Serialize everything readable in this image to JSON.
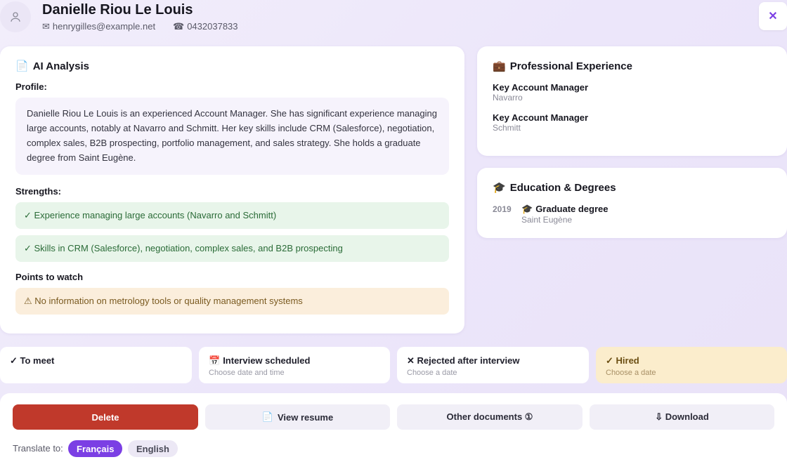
{
  "header": {
    "name": "Danielle Riou Le Louis",
    "email": "henrygilles@example.net",
    "phone": "0432037833",
    "close_label": "✕"
  },
  "ai_analysis": {
    "title": "AI Analysis",
    "profile_label": "Profile:",
    "profile_text": "Danielle Riou Le Louis is an experienced Account Manager. She has significant experience managing large accounts, notably at Navarro and Schmitt. Her key skills include CRM (Salesforce), negotiation, complex sales, B2B prospecting, portfolio management, and sales strategy. She holds a graduate degree from Saint Eugène.",
    "strengths_label": "Strengths:",
    "strengths": [
      "✓ Experience managing large accounts (Navarro and Schmitt)",
      "✓ Skills in CRM (Salesforce), negotiation, complex sales, and B2B prospecting"
    ],
    "watch_label": "Points to watch",
    "watch": [
      "⚠ No information on metrology tools or quality management systems"
    ]
  },
  "experience": {
    "title": "Professional Experience",
    "items": [
      {
        "role": "Key Account Manager",
        "company": "Navarro"
      },
      {
        "role": "Key Account Manager",
        "company": "Schmitt"
      }
    ]
  },
  "education": {
    "title": "Education & Degrees",
    "items": [
      {
        "year": "2019",
        "degree": "Graduate degree",
        "school": "Saint Eugène"
      }
    ]
  },
  "statuses": [
    {
      "label": "✓ To meet",
      "sub": ""
    },
    {
      "label": "Interview scheduled",
      "sub": "Choose date and time"
    },
    {
      "label": "✕ Rejected after interview",
      "sub": "Choose a date"
    },
    {
      "label": "✓ Hired",
      "sub": "Choose a date",
      "active": true
    }
  ],
  "actions": {
    "delete": "Delete",
    "view_resume": "View resume",
    "other_documents": "Other documents ①",
    "download": "⇩ Download"
  },
  "translate": {
    "label": "Translate to:",
    "options": [
      "Français",
      "English"
    ],
    "selected": "Français"
  },
  "colors": {
    "accent": "#7b3fe4",
    "danger": "#c0392b",
    "success_bg": "#e8f5ea",
    "warning_bg": "#fbeedc",
    "hired_bg": "#fbedcc"
  }
}
